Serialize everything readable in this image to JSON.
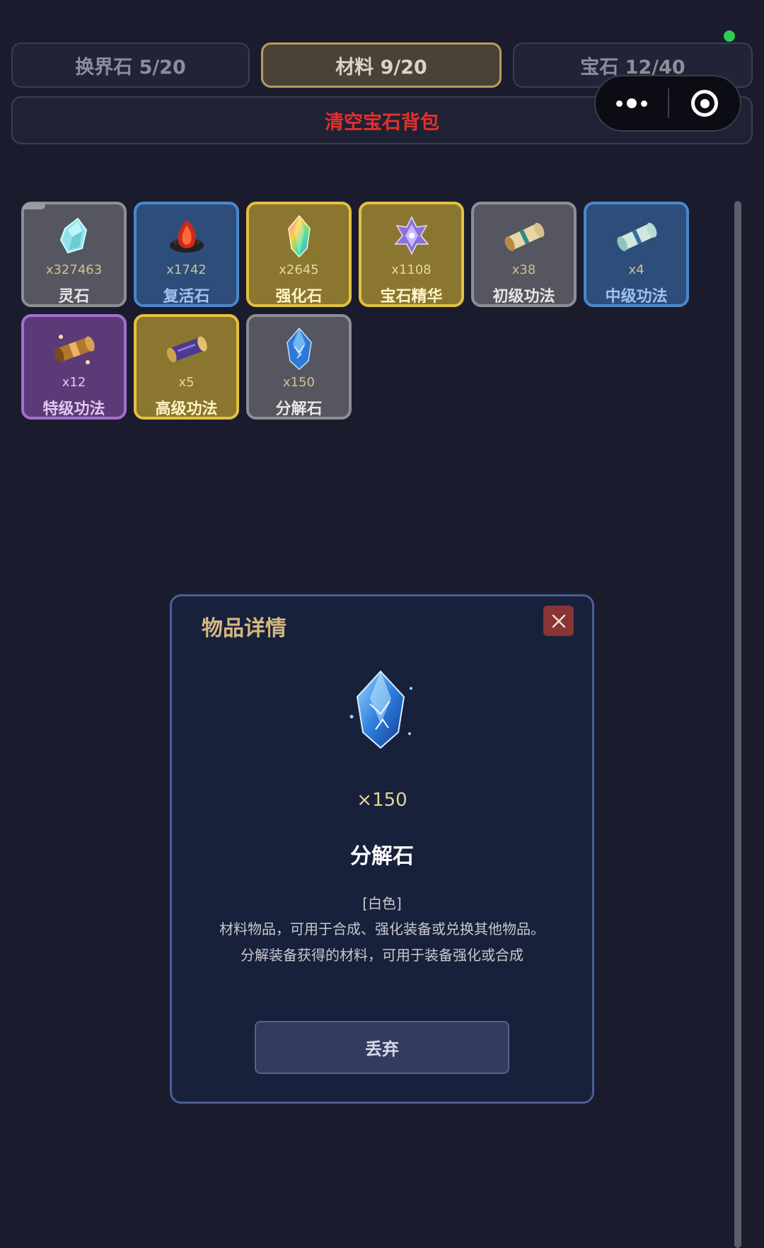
{
  "tabs": [
    {
      "label": "换界石 5/20",
      "active": false
    },
    {
      "label": "材料 9/20",
      "active": true
    },
    {
      "label": "宝石 12/40",
      "active": false
    }
  ],
  "clear_button": {
    "label": "清空宝石背包",
    "color": "#e0312c"
  },
  "items": [
    {
      "count": "x327463",
      "name": "灵石",
      "quality": "gray",
      "icon": "spirit-stone-icon"
    },
    {
      "count": "x1742",
      "name": "复活石",
      "quality": "blue",
      "icon": "revive-stone-icon"
    },
    {
      "count": "x2645",
      "name": "强化石",
      "quality": "gold",
      "icon": "enhance-stone-icon"
    },
    {
      "count": "x1108",
      "name": "宝石精华",
      "quality": "gold",
      "icon": "gem-essence-icon"
    },
    {
      "count": "x38",
      "name": "初级功法",
      "quality": "gray",
      "icon": "scroll-icon"
    },
    {
      "count": "x4",
      "name": "中级功法",
      "quality": "blue",
      "icon": "scroll-icon"
    },
    {
      "count": "x12",
      "name": "特级功法",
      "quality": "purple",
      "icon": "scroll-icon"
    },
    {
      "count": "x5",
      "name": "高级功法",
      "quality": "gold",
      "icon": "scroll-icon"
    },
    {
      "count": "x150",
      "name": "分解石",
      "quality": "gray",
      "icon": "decompose-stone-icon"
    }
  ],
  "modal": {
    "title": "物品详情",
    "quantity": "×150",
    "item_name": "分解石",
    "rarity": "[白色]",
    "description_line1": "材料物品，可用于合成、强化装备或兑换其他物品。",
    "description_line2": "分解装备获得的材料，可用于装备强化或合成",
    "discard_label": "丢弃"
  },
  "colors": {
    "background": "#1a1c2e",
    "quality_gray": "#55565f",
    "quality_blue": "#2e4d7b",
    "quality_gold": "#8a762f",
    "quality_purple": "#5c3a78"
  }
}
